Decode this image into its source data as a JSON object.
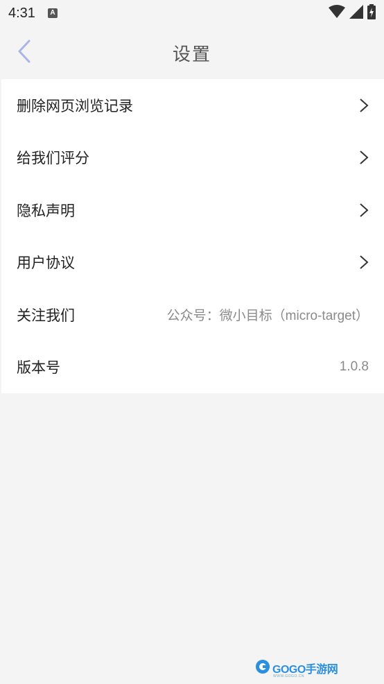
{
  "status_bar": {
    "time": "4:31",
    "notification_icon": "A",
    "icons": [
      "wifi-icon",
      "signal-icon",
      "battery-icon"
    ]
  },
  "header": {
    "title": "设置",
    "back_icon": "chevron-left-icon",
    "accent_color": "#a9b4e8"
  },
  "settings": {
    "items": [
      {
        "label": "删除网页浏览记录",
        "chevron": true
      },
      {
        "label": "给我们评分",
        "chevron": true
      },
      {
        "label": "隐私声明",
        "chevron": true
      },
      {
        "label": "用户协议",
        "chevron": true
      },
      {
        "label": "关注我们",
        "value": "公众号：微小目标（micro-target）"
      },
      {
        "label": "版本号",
        "value": "1.0.8"
      }
    ]
  },
  "watermark": {
    "text": "GOGO手游网",
    "sub": "WWW.GOGO.CN"
  }
}
